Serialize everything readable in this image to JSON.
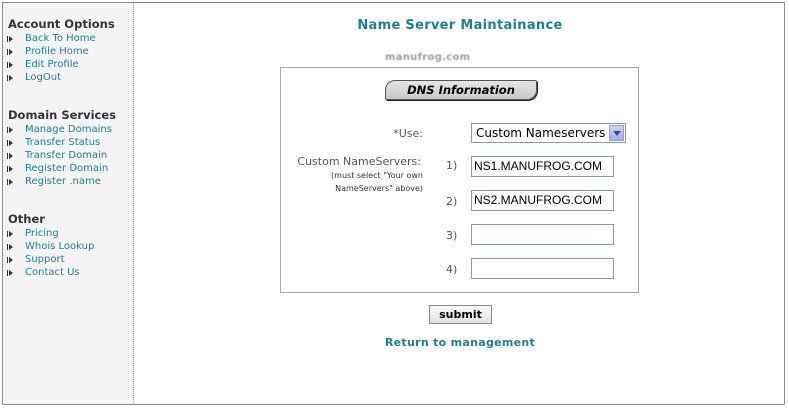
{
  "sidebar": {
    "sections": [
      {
        "title": "Account Options",
        "items": [
          "Back To Home",
          "Profile Home",
          "Edit Profile",
          "LogOut"
        ]
      },
      {
        "title": "Domain Services",
        "items": [
          "Manage Domains",
          "Transfer Status",
          "Transfer Domain",
          "Register Domain",
          "Register .name"
        ]
      },
      {
        "title": "Other",
        "items": [
          "Pricing",
          "Whois Lookup",
          "Support",
          "Contact Us"
        ]
      }
    ]
  },
  "main": {
    "title": "Name Server Maintainance",
    "logo_text": "manufrog.com",
    "dns_tab_label": "DNS Information",
    "use_label": "*Use:",
    "use_value": "Custom Nameservers",
    "custom_label": "Custom NameServers:",
    "custom_note_line1": "(must select \"Your own",
    "custom_note_line2": "NameServers\" above)",
    "nameservers": [
      {
        "num": "1)",
        "value": "NS1.MANUFROG.COM"
      },
      {
        "num": "2)",
        "value": "NS2.MANUFROG.COM"
      },
      {
        "num": "3)",
        "value": ""
      },
      {
        "num": "4)",
        "value": ""
      }
    ],
    "submit_label": "submit",
    "return_label": "Return to management"
  },
  "colors": {
    "link": "#1d7f8f",
    "sidebar_bg": "#f4f4f4"
  }
}
